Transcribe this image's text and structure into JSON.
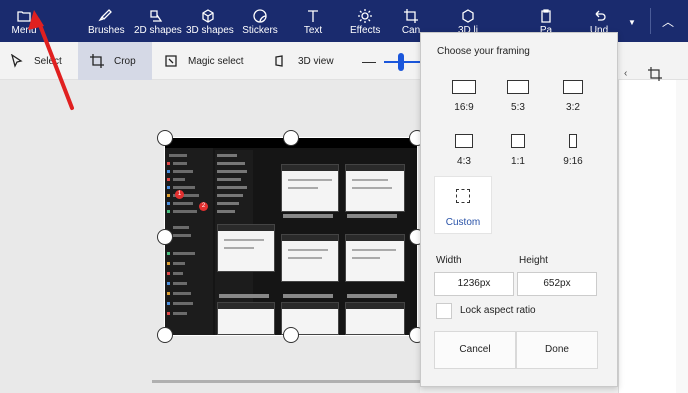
{
  "ribbon": {
    "menu_label": "Menu",
    "tools": [
      {
        "label": "Brushes",
        "icon": "brush-icon"
      },
      {
        "label": "2D shapes",
        "icon": "shapes-2d-icon"
      },
      {
        "label": "3D shapes",
        "icon": "cube-icon"
      },
      {
        "label": "Stickers",
        "icon": "sticker-icon"
      },
      {
        "label": "Text",
        "icon": "text-icon"
      },
      {
        "label": "Effects",
        "icon": "sun-icon"
      },
      {
        "label": "Can",
        "icon": "canvas-icon"
      },
      {
        "label": "3D li",
        "icon": "library-3d-icon"
      },
      {
        "label": "Pa",
        "icon": "paste-icon"
      },
      {
        "label": "Und",
        "icon": "undo-icon"
      }
    ]
  },
  "toolbar": {
    "select_label": "Select",
    "crop_label": "Crop",
    "magic_select_label": "Magic select",
    "view3d_label": "3D view"
  },
  "crop_panel": {
    "title": "Choose your framing",
    "ratios": [
      "16:9",
      "5:3",
      "3:2",
      "4:3",
      "1:1",
      "9:16"
    ],
    "custom_label": "Custom",
    "width_label": "Width",
    "height_label": "Height",
    "width_value": "1236px",
    "height_value": "652px",
    "lock_label": "Lock aspect ratio",
    "cancel_label": "Cancel",
    "done_label": "Done"
  },
  "image": {
    "callouts": [
      "1",
      "2"
    ]
  },
  "colors": {
    "ribbon_bg": "#1a2b6e",
    "accent": "#1a56db",
    "annotation_arrow": "#e02020"
  }
}
